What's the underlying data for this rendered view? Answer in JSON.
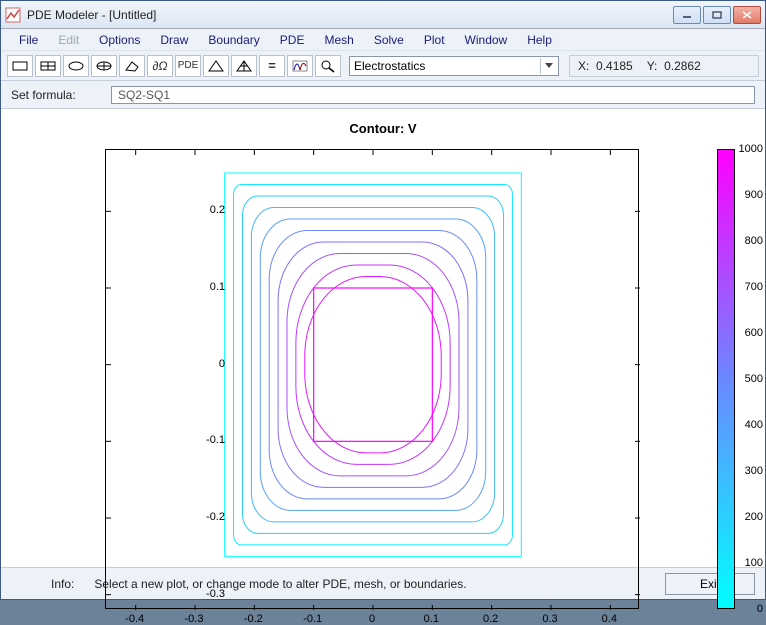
{
  "window": {
    "title": "PDE Modeler - [Untitled]"
  },
  "menu": {
    "items": [
      "File",
      "Edit",
      "Options",
      "Draw",
      "Boundary",
      "PDE",
      "Mesh",
      "Solve",
      "Plot",
      "Window",
      "Help"
    ],
    "disabled_index": 1
  },
  "toolbar": {
    "mode_dropdown": "Electrostatics",
    "coord_x_label": "X:",
    "coord_x_value": "0.4185",
    "coord_y_label": "Y:",
    "coord_y_value": "0.2862"
  },
  "formula": {
    "label": "Set formula:",
    "value": "SQ2-SQ1"
  },
  "plot": {
    "title": "Contour: V",
    "x_ticks": [
      -0.4,
      -0.3,
      -0.2,
      -0.1,
      0,
      0.1,
      0.2,
      0.3,
      0.4
    ],
    "y_ticks": [
      -0.3,
      -0.2,
      -0.1,
      0,
      0.1,
      0.2
    ],
    "xlim": [
      -0.45,
      0.45
    ],
    "ylim": [
      -0.32,
      0.28
    ]
  },
  "colorbar": {
    "ticks": [
      0,
      100,
      200,
      300,
      400,
      500,
      600,
      700,
      800,
      900,
      1000
    ],
    "min": 0,
    "max": 1000
  },
  "chart_data": {
    "type": "contour",
    "title": "Contour: V",
    "xlabel": "",
    "ylabel": "",
    "xlim": [
      -0.45,
      0.45
    ],
    "ylim": [
      -0.32,
      0.28
    ],
    "domain_outer_square": {
      "xmin": -0.25,
      "xmax": 0.25,
      "ymin": -0.25,
      "ymax": 0.25
    },
    "domain_inner_square": {
      "xmin": -0.1,
      "xmax": 0.1,
      "ymin": -0.1,
      "ymax": 0.1
    },
    "levels": [
      0,
      100,
      200,
      300,
      400,
      500,
      600,
      700,
      800,
      900,
      1000
    ],
    "boundary_values": {
      "outer": 0,
      "inner": 1000
    },
    "colormap_endpoints": {
      "low": "#00ffff",
      "high": "#ff00ff"
    }
  },
  "status": {
    "info_label": "Info:",
    "info_text": "Select a new plot, or change mode to alter PDE, mesh, or boundaries.",
    "exit_label": "Exit"
  }
}
